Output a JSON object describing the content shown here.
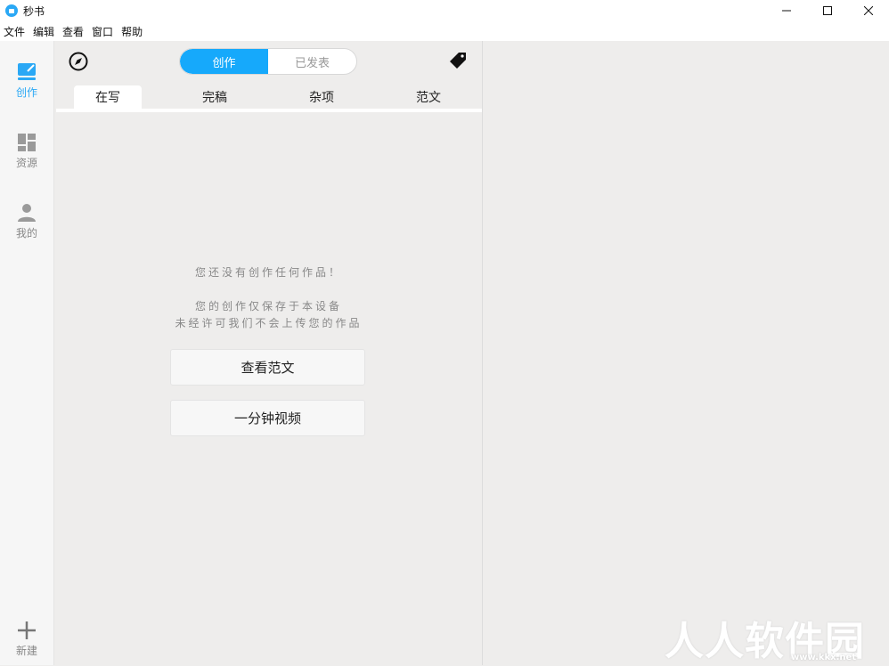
{
  "window": {
    "title": "秒书"
  },
  "menu": [
    "文件",
    "编辑",
    "查看",
    "窗口",
    "帮助"
  ],
  "sidebar": {
    "items": [
      {
        "label": "创作",
        "icon": "edit-icon",
        "active": true
      },
      {
        "label": "资源",
        "icon": "grid-icon",
        "active": false
      },
      {
        "label": "我的",
        "icon": "user-icon",
        "active": false
      }
    ],
    "new_label": "新建"
  },
  "segmented": {
    "left": "创作",
    "right": "已发表"
  },
  "subtabs": [
    "在写",
    "完稿",
    "杂项",
    "范文"
  ],
  "empty_state": {
    "line1": "您还没有创作任何作品！",
    "line2": "您的创作仅保存于本设备",
    "line3": "未经许可我们不会上传您的作品"
  },
  "buttons": {
    "view_samples": "查看范文",
    "one_minute_video": "一分钟视频"
  },
  "watermark": {
    "text": "人人软件园",
    "url": "www.kkx.net"
  },
  "colors": {
    "accent": "#16a9fb",
    "background": "#eeedec"
  }
}
